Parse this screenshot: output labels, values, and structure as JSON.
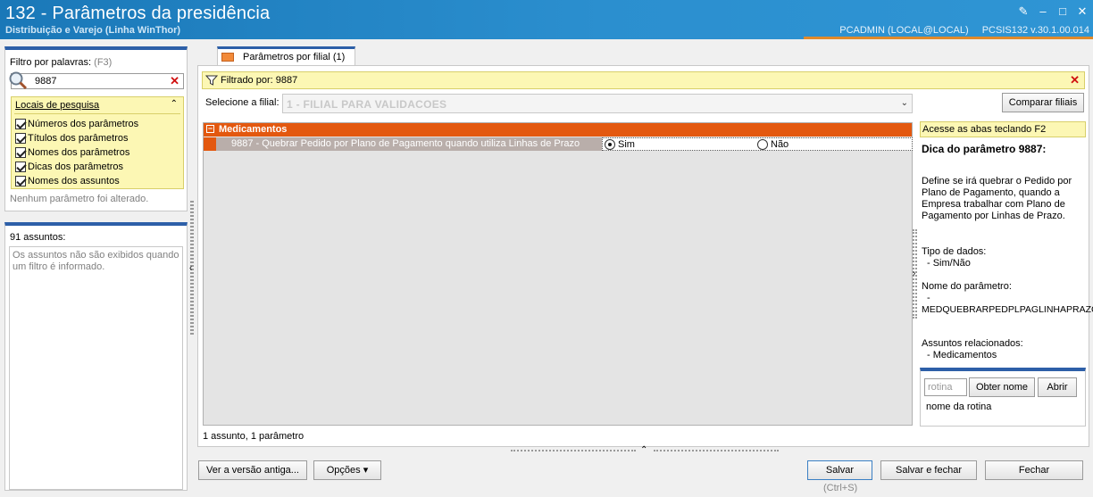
{
  "window": {
    "title": "132 - Parâmetros da presidência",
    "subtitle": "Distribuição e Varejo (Linha WinThor)",
    "user": "PCADMIN (LOCAL@LOCAL)",
    "version": "PCSIS132  v.30.1.00.014"
  },
  "left": {
    "filter_label": "Filtro por palavras:",
    "filter_shortcut": "(F3)",
    "filter_value": "9887",
    "locais_title": "Locais de pesquisa",
    "locais": [
      {
        "label": "Números dos parâmetros",
        "checked": true
      },
      {
        "label": "Títulos dos parâmetros",
        "checked": true
      },
      {
        "label": "Nomes dos parâmetros",
        "checked": true
      },
      {
        "label": "Dicas dos parâmetros",
        "checked": true
      },
      {
        "label": "Nomes dos assuntos",
        "checked": true
      }
    ],
    "status": "Nenhum parâmetro foi alterado.",
    "assuntos_title": "91 assuntos:",
    "assuntos_note": "Os assuntos não são exibidos quando um filtro é informado."
  },
  "main": {
    "tab_label": "Parâmetros por filial  (1)",
    "filter_text": "Filtrado por: 9887",
    "filial_label": "Selecione a filial:",
    "filial_value": "1 - FILIAL PARA VALIDACOES",
    "compare_button": "Comparar filiais",
    "group_name": "Medicamentos",
    "param_desc": "9887 - Quebrar Pedido por Plano de Pagamento quando utiliza Linhas de Prazo",
    "option_yes": "Sim",
    "option_no": "Não",
    "selected_option": "Sim",
    "count_text": "1 assunto, 1 parâmetro"
  },
  "right": {
    "hint": "Acesse as abas teclando F2",
    "tip_title": "Dica do parâmetro 9887:",
    "tip_body": "Define se irá quebrar o Pedido por Plano de Pagamento, quando a Empresa trabalhar com Plano de Pagamento por Linhas de Prazo.",
    "tipo_label": "Tipo de dados:",
    "tipo_value": "- Sim/Não",
    "nome_label": "Nome do parâmetro:",
    "nome_dash": "-",
    "nome_value": "MEDQUEBRARPEDPLPAGLINHAPRAZC",
    "assuntos_label": "Assuntos relacionados:",
    "assuntos_value": "- Medicamentos",
    "rotina_placeholder": "rotina",
    "obter_button": "Obter nome",
    "abrir_button": "Abrir",
    "rotina_name": "nome da rotina"
  },
  "footer": {
    "old_version": "Ver a versão antiga...",
    "options": "Opções",
    "save": "Salvar",
    "save_close": "Salvar e fechar",
    "close": "Fechar",
    "save_shortcut": "(Ctrl+S)"
  }
}
